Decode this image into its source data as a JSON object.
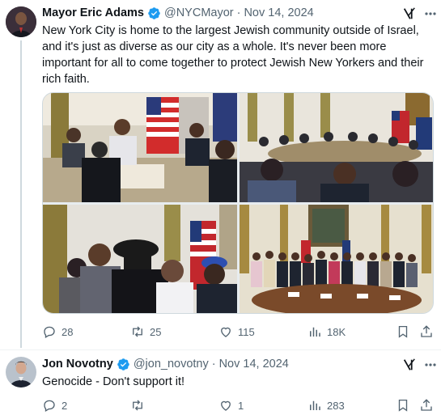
{
  "tweets": [
    {
      "author": "Mayor Eric Adams",
      "handle": "@NYCMayor",
      "separator": "·",
      "date": "Nov 14, 2024",
      "text": "New York City is home to the largest Jewish community outside of Israel, and it's just as diverse as our city as a whole. It's never been more important for all to come together to protect Jewish New Yorkers and their rich faith.",
      "stats": {
        "replies": "28",
        "reposts": "25",
        "likes": "115",
        "views": "18K"
      }
    },
    {
      "author": "Jon Novotny",
      "handle": "@jon_novotny",
      "separator": "·",
      "date": "Nov 14, 2024",
      "text": "Genocide - Don't support it!",
      "stats": {
        "replies": "2",
        "reposts": "",
        "likes": "1",
        "views": "283"
      }
    }
  ],
  "icons": [
    "verified-badge-icon",
    "grok-icon",
    "more-icon",
    "reply-icon",
    "repost-icon",
    "like-icon",
    "views-icon",
    "bookmark-icon",
    "share-icon"
  ],
  "colors": {
    "verified": "#1d9bf0",
    "text": "#0f1419",
    "secondary": "#536471",
    "border": "#cfd9de"
  }
}
